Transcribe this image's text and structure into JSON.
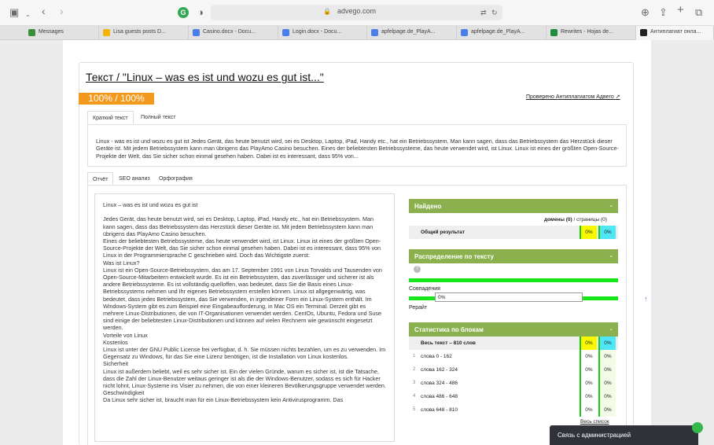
{
  "browser": {
    "url": "advego.com",
    "profile_initial": "G",
    "tabs": [
      {
        "label": "Messages",
        "color": "#3a8f3a"
      },
      {
        "label": "Lisa guests posts D...",
        "color": "#f4b400"
      },
      {
        "label": "Casino.docx - Docu...",
        "color": "#4a7ee8"
      },
      {
        "label": "Login.docx - Docu...",
        "color": "#4a7ee8"
      },
      {
        "label": "apfelpage.de_PlayA...",
        "color": "#4a7ee8"
      },
      {
        "label": "apfelpage.de_PlayA...",
        "color": "#4a7ee8"
      },
      {
        "label": "Rewrites - Hojas de...",
        "color": "#1e8e3e"
      },
      {
        "label": "Антиплагиат онла...",
        "color": "#222222"
      }
    ]
  },
  "page": {
    "title": "Текст / \"Linux – was es ist und wozu es gut ist...\"",
    "uniqueness": "100% / 100%",
    "checked_link": "Проверено Антиплагиатом Адвего",
    "text_tabs": [
      "Краткий текст",
      "Полный текст"
    ],
    "summary": "Linux - was es ist und wozu es gut ist Jedes Gerät, das heute benutzt wird, sei es Desktop, Laptop, iPad, Handy etc., hat ein Betriebssystem. Man kann sagen, dass das Betriebssystem das Herzstück dieser Geräte ist. Mit jedem Betriebssystem kann man übrigens das PlayAmo Casino besuchen. Eines der beliebtesten Betriebssysteme, das heute verwendet wird, ist Linux. Linux ist eines der größten Open-Source-Projekte der Welt, das Sie sicher schon einmal gesehen haben. Dabei ist es interessant, dass 95% von...",
    "report_tabs": [
      "Отчёт",
      "SEO анализ",
      "Орфография"
    ],
    "full_text": "Linux – was es ist und wozu es gut ist\n\nJedes Gerät, das heute benutzt wird, sei es Desktop, Laptop, iPad, Handy etc., hat ein Betriebssystem. Man kann sagen, dass das Betriebssystem das Herzstück dieser Geräte ist. Mit jedem Betriebssystem kann man übrigens das PlayAmo Casino besuchen.\nEines der beliebtesten Betriebssysteme, das heute verwendet wird, ist Linux. Linux ist eines der größten Open-Source-Projekte der Welt, das Sie sicher schon einmal gesehen haben. Dabei ist es interessant, dass 95% von Linux in der Programmiersprache C geschrieben wird. Doch das Wichtigste zuerst:\nWas ist Linux?\nLinux ist ein Open-Source-Betriebssystem, das am 17. September 1991 von Linus Torvalds und Tausenden von Open-Source-Mitarbeitern entwickelt wurde. Es ist ein Betriebssystem, das zuverlässiger und sicherer ist als andere Betriebssysteme. Es ist vollständig quelloffen, was bedeutet, dass Sie die Basis eines Linux-Betriebssystems nehmen und Ihr eigenes Betriebssystem erstellen können. Linux ist allgegenwärtig, was bedeutet, dass jedes Betriebssystem, das Sie verwenden, in irgendeiner Form ein Linux-System enthält. Im Windows-System gibt es zum Beispiel eine Eingabeaufforderung, in Mac OS ein Terminal. Derzeit gibt es mehrere Linux-Distributionen, die von IT-Organisationen verwendet werden. CentOs, Ubuntu, Fedora und Suse sind einige der beliebtesten Linux-Distributionen und können auf vielen Rechnern wie gewünscht eingesetzt werden.\nVorteile von Linux\nKostenlos\nLinux ist unter der GNU Public License frei verfügbar, d. h. Sie müssen nichts bezahlen, um es zu verwenden. Im Gegensatz zu Windows, für das Sie eine Lizenz benötigen, ist die Installation von Linux kostenlos.\nSicherheit\nLinux ist außerdem beliebt, weil es sehr sicher ist. Ein der vielen Gründe, warum es sicher ist, ist die Tatsache, dass die Zahl der Linux-Benutzer weitaus geringer ist als die der Windows-Benutzer, sodass es sich für Hacker nicht lohnt, Linux-Systeme ins Visier zu nehmen, die von einer kleineren Bevölkerungsgruppe verwendet werden.\nGeschwindigkeit\nDa Linux sehr sicher ist, braucht man für ein Linux-Betriebssystem kein Antivirusprogramm. Das"
  },
  "found": {
    "header": "Найдено",
    "domains": "домены (0)",
    "separator": "/",
    "pages": "страницы (0)",
    "overall_label": "Общий результат",
    "overall_a": "0%",
    "overall_b": "0%"
  },
  "distribution": {
    "header": "Распределение по тексту",
    "help": "?",
    "matches_label": "Совпадения",
    "matches_value": "0%",
    "matches_fraction": 0,
    "rewrite_label": "Рерайт"
  },
  "blocks": {
    "header": "Статистика по блокам",
    "total_label": "Весь текст – 810 слов",
    "total_a": "0%",
    "total_b": "0%",
    "rows": [
      {
        "num": "1",
        "label": "слова 0 - 162",
        "a": "0%",
        "b": "0%"
      },
      {
        "num": "2",
        "label": "слова 162 - 324",
        "a": "0%",
        "b": "0%"
      },
      {
        "num": "3",
        "label": "слова 324 - 486",
        "a": "0%",
        "b": "0%"
      },
      {
        "num": "4",
        "label": "слова 486 - 648",
        "a": "0%",
        "b": "0%"
      },
      {
        "num": "5",
        "label": "слова 648 - 810",
        "a": "0%",
        "b": "0%"
      }
    ],
    "all_list": "Весь список"
  },
  "chat": {
    "label": "Связь с администрацией"
  },
  "colors": {
    "accent_green": "#8ab14e",
    "bar_green": "#19e619",
    "orange": "#f39a1e"
  }
}
